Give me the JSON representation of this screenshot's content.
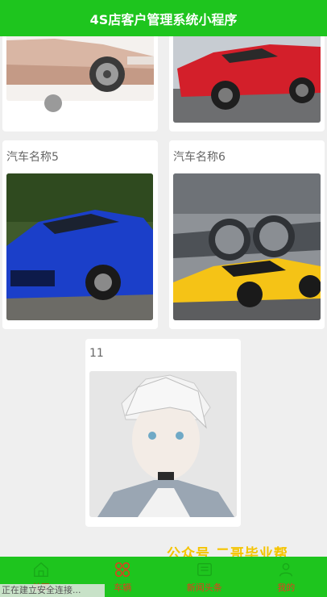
{
  "header": {
    "title": "4S店客户管理系统小程序"
  },
  "cars": [
    {
      "name": ""
    },
    {
      "name": ""
    },
    {
      "name": "汽车名称5"
    },
    {
      "name": "汽车名称6"
    },
    {
      "name": "11"
    }
  ],
  "watermark": "公众号 二哥毕业帮",
  "tabbar": {
    "items": [
      {
        "label": "首页",
        "icon": "home-icon"
      },
      {
        "label": "车辆",
        "icon": "grid-icon"
      },
      {
        "label": "新闻头条",
        "icon": "news-icon"
      },
      {
        "label": "我的",
        "icon": "user-icon"
      }
    ]
  },
  "status": "正在建立安全连接..."
}
